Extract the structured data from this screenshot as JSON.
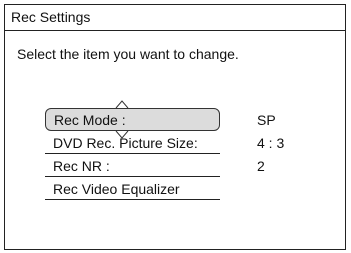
{
  "window": {
    "title": "Rec Settings"
  },
  "instruction": "Select the item you want to change.",
  "menu": {
    "items": [
      {
        "label": "Rec Mode :",
        "value": "SP",
        "selected": true
      },
      {
        "label": "DVD Rec. Picture Size:",
        "value": "4 : 3",
        "selected": false
      },
      {
        "label": "Rec NR :",
        "value": "2",
        "selected": false
      },
      {
        "label": "Rec Video Equalizer",
        "value": "",
        "selected": false
      }
    ]
  },
  "icons": {
    "up": "up-arrow-icon",
    "down": "down-arrow-icon"
  }
}
